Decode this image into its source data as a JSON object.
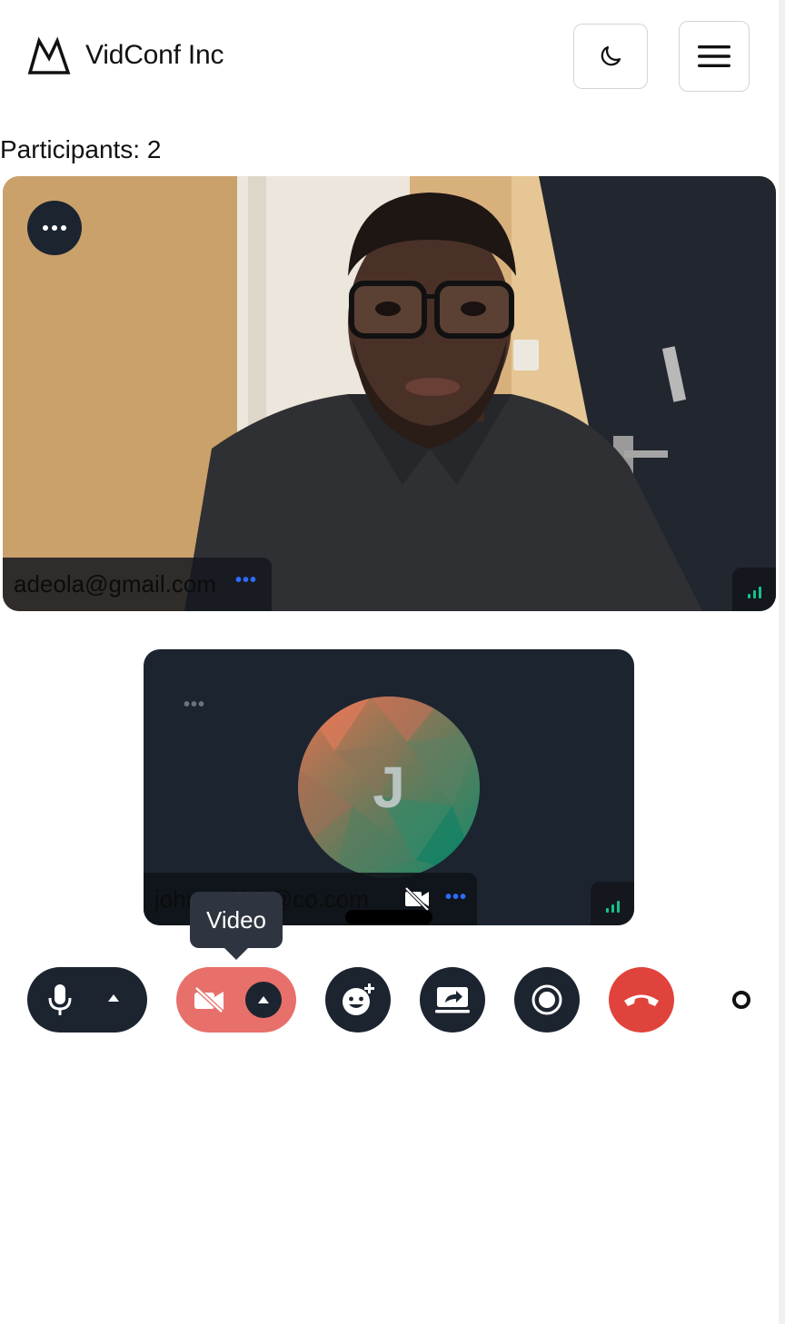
{
  "app": {
    "brand": "VidConf Inc"
  },
  "header": {
    "logo_icon": "mountain-logo-icon",
    "theme_toggle_icon": "moon-icon",
    "menu_icon": "hamburger-menu-icon"
  },
  "participants_label": "Participants: 2",
  "tiles": [
    {
      "name": "adeola@gmail.com",
      "video": "on",
      "options_icon": "more-horizontal-icon"
    },
    {
      "name": "johnsmith9@co.com",
      "avatar_letter": "J",
      "video": "off",
      "options_icon": "more-horizontal-icon"
    }
  ],
  "tooltip": {
    "text": "Video"
  },
  "controls": {
    "mic": {
      "icon": "microphone-icon"
    },
    "video": {
      "icon": "video-off-icon",
      "state": "off"
    },
    "reactions": {
      "icon": "emoji-add-icon"
    },
    "share": {
      "icon": "screen-share-icon"
    },
    "record": {
      "icon": "record-icon"
    },
    "end_call": {
      "icon": "hang-up-icon"
    }
  },
  "colors": {
    "dark": "#1c2430",
    "video_off": "#e8706b",
    "end_call": "#e0433b",
    "signal": "#16c08a",
    "accent_dots": "#2f6bff"
  }
}
